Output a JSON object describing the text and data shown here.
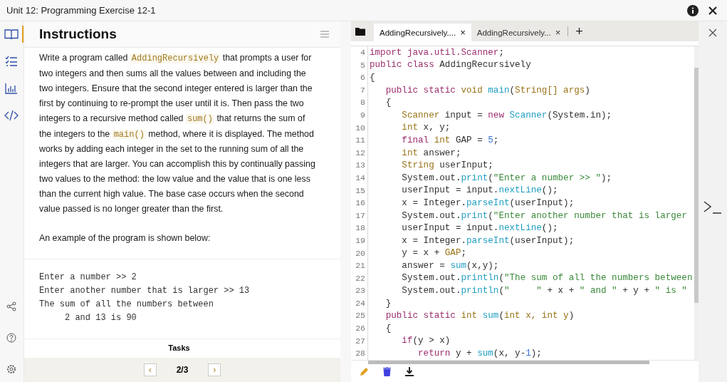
{
  "window": {
    "title": "Unit 12: Programming Exercise 12-1"
  },
  "sidebar": {
    "items": [
      {
        "kind": "book",
        "selected": true
      },
      {
        "kind": "checklist",
        "selected": false
      },
      {
        "kind": "chart",
        "selected": false
      },
      {
        "kind": "code",
        "selected": false
      }
    ],
    "bottom_items": [
      {
        "kind": "share"
      },
      {
        "kind": "help"
      },
      {
        "kind": "settings"
      }
    ]
  },
  "instructions": {
    "title": "Instructions",
    "paragraph": [
      {
        "kind": "text",
        "text": "Write a program called "
      },
      {
        "kind": "code",
        "text": "AddingRecursively"
      },
      {
        "kind": "text",
        "text": " that prompts a user for two integers and then sums all the values between and including the two integers. Ensure that the second integer entered is larger than the first by continuing to re-prompt the user until it is. Then pass the two integers to a recursive method called "
      },
      {
        "kind": "code",
        "text": "sum()"
      },
      {
        "kind": "text",
        "text": " that returns the sum of the integers to the "
      },
      {
        "kind": "code",
        "text": "main()"
      },
      {
        "kind": "text",
        "text": " method, where it is displayed. The method works by adding each integer in the set to the running sum of all the integers that are larger. You can accomplish this by continually passing two values to the method: the low value and the value that is one less than the current high value. The base case occurs when the second value passed is no longer greater than the first."
      }
    ],
    "example_intro": "An example of the program is shown below:",
    "example_output": [
      "Enter a number >> 2",
      "Enter another number that is larger >> 13",
      "The sum of all the numbers between",
      "     2 and 13 is 90"
    ],
    "next_heading": "Tasks",
    "pager": {
      "prev": "‹",
      "page": "2/3",
      "next": "›"
    }
  },
  "editor": {
    "tabs": [
      {
        "label": "AddingRecursively....",
        "close": "×",
        "selected": true
      },
      {
        "label": "AddingRecursively...",
        "close": "×",
        "selected": false
      }
    ],
    "add_tab": "+",
    "lines": [
      {
        "num": "4",
        "tokens": [
          {
            "kind": "kw",
            "text": "import java.util.Scanner"
          },
          {
            "kind": "pl",
            "text": ";"
          }
        ]
      },
      {
        "num": "5",
        "tokens": [
          {
            "kind": "kw",
            "text": "public class"
          },
          {
            "kind": "pl",
            "text": " AddingRecursively"
          }
        ]
      },
      {
        "num": "6",
        "tokens": [
          {
            "kind": "pl",
            "text": "{"
          }
        ]
      },
      {
        "num": "7",
        "tokens": [
          {
            "kind": "kw",
            "text": "   public static "
          },
          {
            "kind": "ty",
            "text": "void "
          },
          {
            "kind": "fn",
            "text": "main"
          },
          {
            "kind": "pl",
            "text": "("
          },
          {
            "kind": "ty",
            "text": "String[] args"
          },
          {
            "kind": "pl",
            "text": ")"
          }
        ]
      },
      {
        "num": "8",
        "tokens": [
          {
            "kind": "pl",
            "text": "   {"
          }
        ]
      },
      {
        "num": "9",
        "tokens": [
          {
            "kind": "ty",
            "text": "      Scanner "
          },
          {
            "kind": "pl",
            "text": "input = "
          },
          {
            "kind": "kw",
            "text": "new "
          },
          {
            "kind": "fn",
            "text": "Scanner"
          },
          {
            "kind": "pl",
            "text": "(System.in);"
          }
        ]
      },
      {
        "num": "10",
        "tokens": [
          {
            "kind": "ty",
            "text": "      int "
          },
          {
            "kind": "pl",
            "text": "x, y;"
          }
        ]
      },
      {
        "num": "11",
        "tokens": [
          {
            "kind": "kw",
            "text": "      final "
          },
          {
            "kind": "ty",
            "text": "int "
          },
          {
            "kind": "pl",
            "text": "GAP = "
          },
          {
            "kind": "num",
            "text": "5"
          },
          {
            "kind": "pl",
            "text": ";"
          }
        ]
      },
      {
        "num": "12",
        "tokens": [
          {
            "kind": "ty",
            "text": "      int "
          },
          {
            "kind": "pl",
            "text": "answer;"
          }
        ]
      },
      {
        "num": "13",
        "tokens": [
          {
            "kind": "ty",
            "text": "      String "
          },
          {
            "kind": "pl",
            "text": "userInput;"
          }
        ]
      },
      {
        "num": "14",
        "tokens": [
          {
            "kind": "pl",
            "text": "      System.out."
          },
          {
            "kind": "fn",
            "text": "print"
          },
          {
            "kind": "pl",
            "text": "("
          },
          {
            "kind": "st",
            "text": "\"Enter a number >> \""
          },
          {
            "kind": "pl",
            "text": ");"
          }
        ]
      },
      {
        "num": "15",
        "tokens": [
          {
            "kind": "pl",
            "text": "      userInput = input."
          },
          {
            "kind": "fn",
            "text": "nextLine"
          },
          {
            "kind": "pl",
            "text": "();"
          }
        ]
      },
      {
        "num": "16",
        "tokens": [
          {
            "kind": "pl",
            "text": "      x = Integer."
          },
          {
            "kind": "fn",
            "text": "parseInt"
          },
          {
            "kind": "pl",
            "text": "(userInput);"
          }
        ]
      },
      {
        "num": "17",
        "tokens": [
          {
            "kind": "pl",
            "text": "      System.out."
          },
          {
            "kind": "fn",
            "text": "print"
          },
          {
            "kind": "pl",
            "text": "("
          },
          {
            "kind": "st",
            "text": "\"Enter another number that is larger"
          }
        ]
      },
      {
        "num": "18",
        "tokens": [
          {
            "kind": "pl",
            "text": "      userInput = input."
          },
          {
            "kind": "fn",
            "text": "nextLine"
          },
          {
            "kind": "pl",
            "text": "();"
          }
        ]
      },
      {
        "num": "19",
        "tokens": [
          {
            "kind": "pl",
            "text": "      x = Integer."
          },
          {
            "kind": "fn",
            "text": "parseInt"
          },
          {
            "kind": "pl",
            "text": "(userInput);"
          }
        ]
      },
      {
        "num": "20",
        "tokens": [
          {
            "kind": "pl",
            "text": "      y = x + "
          },
          {
            "kind": "ty",
            "text": "GAP"
          },
          {
            "kind": "pl",
            "text": ";"
          }
        ]
      },
      {
        "num": "21",
        "tokens": [
          {
            "kind": "pl",
            "text": "      answer = "
          },
          {
            "kind": "fn",
            "text": "sum"
          },
          {
            "kind": "pl",
            "text": "(x,y);"
          }
        ]
      },
      {
        "num": "22",
        "tokens": [
          {
            "kind": "pl",
            "text": "      System.out."
          },
          {
            "kind": "fn",
            "text": "println"
          },
          {
            "kind": "pl",
            "text": "("
          },
          {
            "kind": "st",
            "text": "\"The sum of all the numbers between"
          }
        ]
      },
      {
        "num": "23",
        "tokens": [
          {
            "kind": "pl",
            "text": "      System.out."
          },
          {
            "kind": "fn",
            "text": "println"
          },
          {
            "kind": "pl",
            "text": "("
          },
          {
            "kind": "st",
            "text": "\"     \""
          },
          {
            "kind": "pl",
            "text": " + x + "
          },
          {
            "kind": "st",
            "text": "\" and \""
          },
          {
            "kind": "pl",
            "text": " + y + "
          },
          {
            "kind": "st",
            "text": "\" is \""
          }
        ]
      },
      {
        "num": "24",
        "tokens": [
          {
            "kind": "pl",
            "text": "   }"
          }
        ]
      },
      {
        "num": "25",
        "tokens": [
          {
            "kind": "kw",
            "text": "   public static "
          },
          {
            "kind": "ty",
            "text": "int "
          },
          {
            "kind": "fn",
            "text": "sum"
          },
          {
            "kind": "pl",
            "text": "("
          },
          {
            "kind": "ty",
            "text": "int x, int y"
          },
          {
            "kind": "pl",
            "text": ")"
          }
        ]
      },
      {
        "num": "26",
        "tokens": [
          {
            "kind": "pl",
            "text": "   {"
          }
        ]
      },
      {
        "num": "27",
        "tokens": [
          {
            "kind": "kw",
            "text": "      if"
          },
          {
            "kind": "pl",
            "text": "(y > x)"
          }
        ]
      },
      {
        "num": "28",
        "tokens": [
          {
            "kind": "kw",
            "text": "         return "
          },
          {
            "kind": "pl",
            "text": "y + "
          },
          {
            "kind": "fn",
            "text": "sum"
          },
          {
            "kind": "pl",
            "text": "(x, y-"
          },
          {
            "kind": "num",
            "text": "1"
          },
          {
            "kind": "pl",
            "text": ");"
          }
        ]
      }
    ],
    "toolbar": [
      {
        "kind": "edit"
      },
      {
        "kind": "delete"
      },
      {
        "kind": "download"
      }
    ]
  },
  "terminal": {
    "kind": "terminal"
  }
}
